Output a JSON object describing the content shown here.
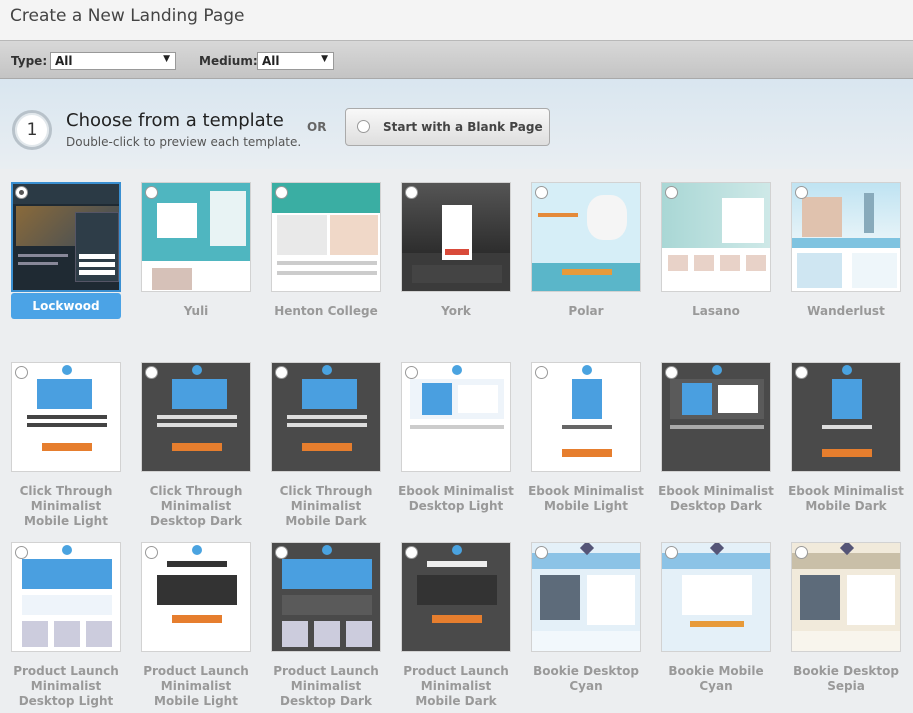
{
  "page": {
    "title": "Create a New Landing Page"
  },
  "filters": {
    "type_label": "Type:",
    "type_value": "All",
    "medium_label": "Medium:",
    "medium_value": "All"
  },
  "step": {
    "number": "1",
    "heading": "Choose from a template",
    "subtext": "Double-click to preview each template.",
    "or_label": "OR",
    "blank_button": "Start with a Blank Page"
  },
  "templates": [
    {
      "name": "Lockwood",
      "selected": true
    },
    {
      "name": "Yuli"
    },
    {
      "name": "Henton College"
    },
    {
      "name": "York"
    },
    {
      "name": "Polar"
    },
    {
      "name": "Lasano"
    },
    {
      "name": "Wanderlust"
    },
    {
      "name": "Click Through Minimalist Mobile Light"
    },
    {
      "name": "Click Through Minimalist Desktop Dark"
    },
    {
      "name": "Click Through Minimalist Mobile Dark"
    },
    {
      "name": "Ebook Minimalist Desktop Light"
    },
    {
      "name": "Ebook Minimalist Mobile Light"
    },
    {
      "name": "Ebook Minimalist Desktop Dark"
    },
    {
      "name": "Ebook Minimalist Mobile Dark"
    },
    {
      "name": "Product Launch Minimalist Desktop Light"
    },
    {
      "name": "Product Launch Minimalist Mobile Light"
    },
    {
      "name": "Product Launch Minimalist Desktop Dark"
    },
    {
      "name": "Product Launch Minimalist Mobile Dark"
    },
    {
      "name": "Bookie Desktop Cyan"
    },
    {
      "name": "Bookie Mobile Cyan"
    },
    {
      "name": "Bookie Desktop Sepia"
    }
  ],
  "colors": {
    "accent": "#4ba3e6",
    "dark_template": "#4a4a4a"
  }
}
